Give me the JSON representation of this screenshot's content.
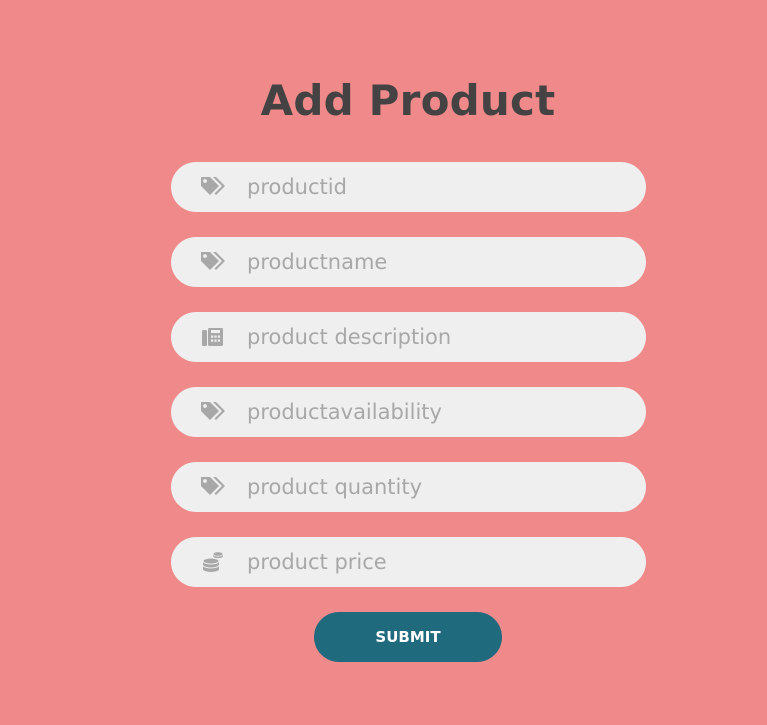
{
  "page": {
    "title": "Add Product",
    "background_color": "#f08a8a",
    "field_background": "#efefef",
    "icon_color": "#a8a8a8",
    "title_color": "#444242"
  },
  "form": {
    "fields": [
      {
        "placeholder": "productid",
        "value": "",
        "icon": "tags-icon"
      },
      {
        "placeholder": "productname",
        "value": "",
        "icon": "tags-icon"
      },
      {
        "placeholder": "product description",
        "value": "",
        "icon": "fax-icon"
      },
      {
        "placeholder": "productavailability",
        "value": "",
        "icon": "tags-icon"
      },
      {
        "placeholder": "product quantity",
        "value": "",
        "icon": "tags-icon"
      },
      {
        "placeholder": "product price",
        "value": "",
        "icon": "coins-icon"
      }
    ],
    "submit_label": "SUBMIT",
    "submit_color": "#206a7e"
  }
}
